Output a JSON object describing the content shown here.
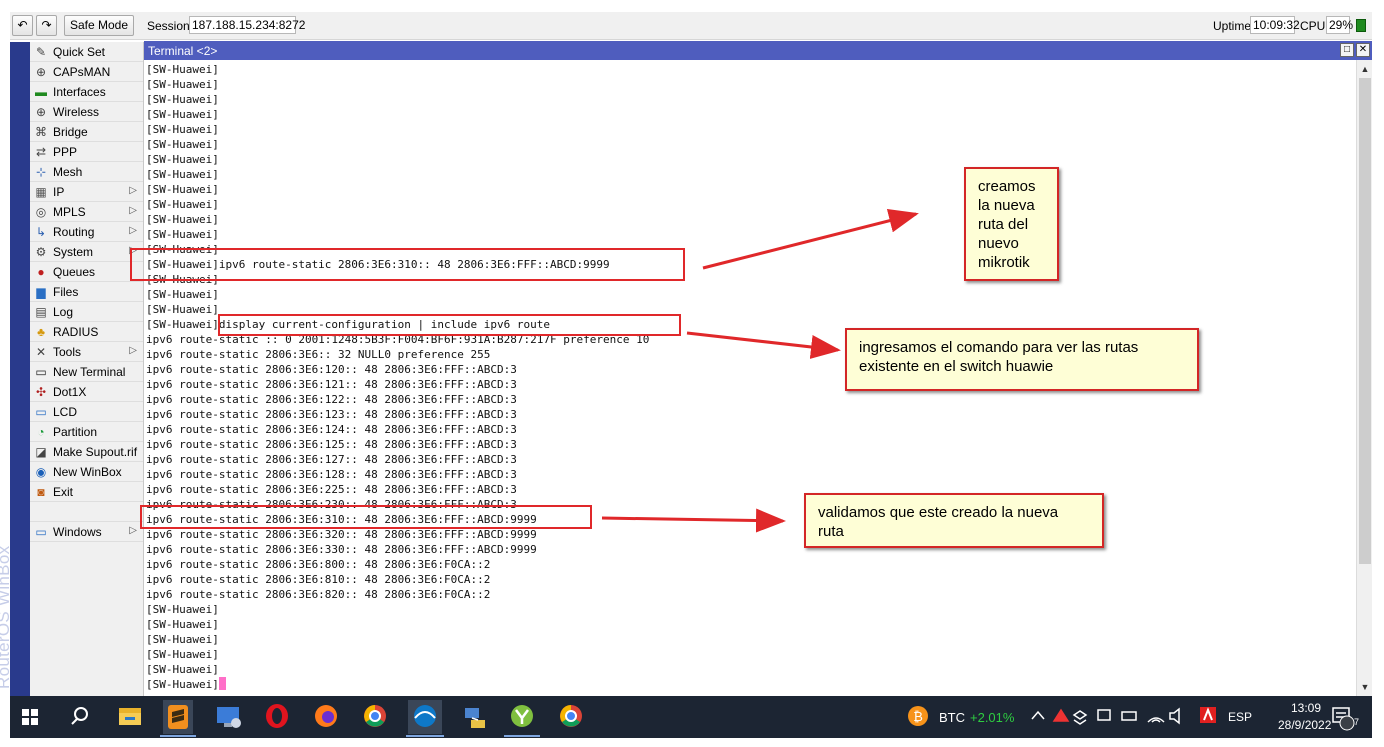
{
  "toolbar": {
    "safe_mode": "Safe Mode",
    "session_label": "Session:",
    "session_value": "187.188.15.234:8272",
    "uptime_label": "Uptime:",
    "uptime_value": "10:09:32",
    "cpu_label": "CPU:",
    "cpu_value": "29%"
  },
  "brand": "RouterOS WinBox",
  "menu": [
    {
      "label": "Quick Set",
      "icon": "wand-icon"
    },
    {
      "label": "CAPsMAN",
      "icon": "antenna-icon"
    },
    {
      "label": "Interfaces",
      "icon": "interfaces-icon"
    },
    {
      "label": "Wireless",
      "icon": "wireless-icon"
    },
    {
      "label": "Bridge",
      "icon": "bridge-icon"
    },
    {
      "label": "PPP",
      "icon": "ppp-icon"
    },
    {
      "label": "Mesh",
      "icon": "mesh-icon"
    },
    {
      "label": "IP",
      "icon": "ip-icon",
      "submenu": true
    },
    {
      "label": "MPLS",
      "icon": "mpls-icon",
      "submenu": true
    },
    {
      "label": "Routing",
      "icon": "routing-icon",
      "submenu": true
    },
    {
      "label": "System",
      "icon": "gear-icon",
      "submenu": true
    },
    {
      "label": "Queues",
      "icon": "queues-icon"
    },
    {
      "label": "Files",
      "icon": "folder-icon"
    },
    {
      "label": "Log",
      "icon": "log-icon"
    },
    {
      "label": "RADIUS",
      "icon": "radius-icon"
    },
    {
      "label": "Tools",
      "icon": "tools-icon",
      "submenu": true
    },
    {
      "label": "New Terminal",
      "icon": "terminal-icon"
    },
    {
      "label": "Dot1X",
      "icon": "dot1x-icon"
    },
    {
      "label": "LCD",
      "icon": "lcd-icon"
    },
    {
      "label": "Partition",
      "icon": "partition-icon"
    },
    {
      "label": "Make Supout.rif",
      "icon": "supout-icon"
    },
    {
      "label": "New WinBox",
      "icon": "winbox-icon"
    },
    {
      "label": "Exit",
      "icon": "exit-icon"
    },
    {
      "label": "",
      "icon": ""
    },
    {
      "label": "Windows",
      "icon": "windows-icon",
      "submenu": true
    }
  ],
  "terminal": {
    "title": "Terminal <2>",
    "lines": [
      "[SW-Huawei]",
      "[SW-Huawei]",
      "[SW-Huawei]",
      "[SW-Huawei]",
      "[SW-Huawei]",
      "[SW-Huawei]",
      "[SW-Huawei]",
      "[SW-Huawei]",
      "[SW-Huawei]",
      "[SW-Huawei]",
      "[SW-Huawei]",
      "[SW-Huawei]",
      "[SW-Huawei]",
      "[SW-Huawei]ipv6 route-static 2806:3E6:310:: 48 2806:3E6:FFF::ABCD:9999",
      "[SW-Huawei]",
      "[SW-Huawei]",
      "[SW-Huawei]",
      "[SW-Huawei]display current-configuration | include ipv6 route",
      "ipv6 route-static :: 0 2001:1248:5B3F:F004:BF6F:931A:B287:217F preference 10",
      "ipv6 route-static 2806:3E6:: 32 NULL0 preference 255",
      "ipv6 route-static 2806:3E6:120:: 48 2806:3E6:FFF::ABCD:3",
      "ipv6 route-static 2806:3E6:121:: 48 2806:3E6:FFF::ABCD:3",
      "ipv6 route-static 2806:3E6:122:: 48 2806:3E6:FFF::ABCD:3",
      "ipv6 route-static 2806:3E6:123:: 48 2806:3E6:FFF::ABCD:3",
      "ipv6 route-static 2806:3E6:124:: 48 2806:3E6:FFF::ABCD:3",
      "ipv6 route-static 2806:3E6:125:: 48 2806:3E6:FFF::ABCD:3",
      "ipv6 route-static 2806:3E6:127:: 48 2806:3E6:FFF::ABCD:3",
      "ipv6 route-static 2806:3E6:128:: 48 2806:3E6:FFF::ABCD:3",
      "ipv6 route-static 2806:3E6:225:: 48 2806:3E6:FFF::ABCD:3",
      "ipv6 route-static 2806:3E6:230:: 48 2806:3E6:FFF::ABCD:3",
      "ipv6 route-static 2806:3E6:310:: 48 2806:3E6:FFF::ABCD:9999",
      "ipv6 route-static 2806:3E6:320:: 48 2806:3E6:FFF::ABCD:9999",
      "ipv6 route-static 2806:3E6:330:: 48 2806:3E6:FFF::ABCD:9999",
      "ipv6 route-static 2806:3E6:800:: 48 2806:3E6:F0CA::2",
      "ipv6 route-static 2806:3E6:810:: 48 2806:3E6:F0CA::2",
      "ipv6 route-static 2806:3E6:820:: 48 2806:3E6:F0CA::2",
      "[SW-Huawei]",
      "[SW-Huawei]",
      "[SW-Huawei]",
      "[SW-Huawei]",
      "[SW-Huawei]",
      "[SW-Huawei]"
    ]
  },
  "annotations": {
    "note1": [
      "creamos",
      "la nueva",
      "ruta del",
      "nuevo",
      "mikrotik"
    ],
    "note2": [
      "ingresamos el comando para ver las rutas",
      "existente en el switch huawie"
    ],
    "note3": [
      "validamos que este creado la nueva",
      "ruta"
    ]
  },
  "taskbar": {
    "apps": [
      "file-explorer-icon",
      "sublime-text-icon",
      "remote-desktop-icon",
      "opera-icon",
      "firefox-icon",
      "chrome-icon",
      "winbox-app-icon",
      "network-tool-icon",
      "app-icon",
      "chrome-icon"
    ],
    "btc_label": "BTC",
    "btc_change": "+2.01%",
    "lang": "ESP",
    "time": "13:09",
    "date": "28/9/2022",
    "notifications": "7"
  },
  "colors": {
    "title_bar": "#4f5dbe",
    "brand_strip": "#293a8c",
    "highlight": "#e0282a",
    "note_bg": "#fefed6",
    "btc_change": "#2ecc40",
    "cursor": "#ff6fc8"
  }
}
